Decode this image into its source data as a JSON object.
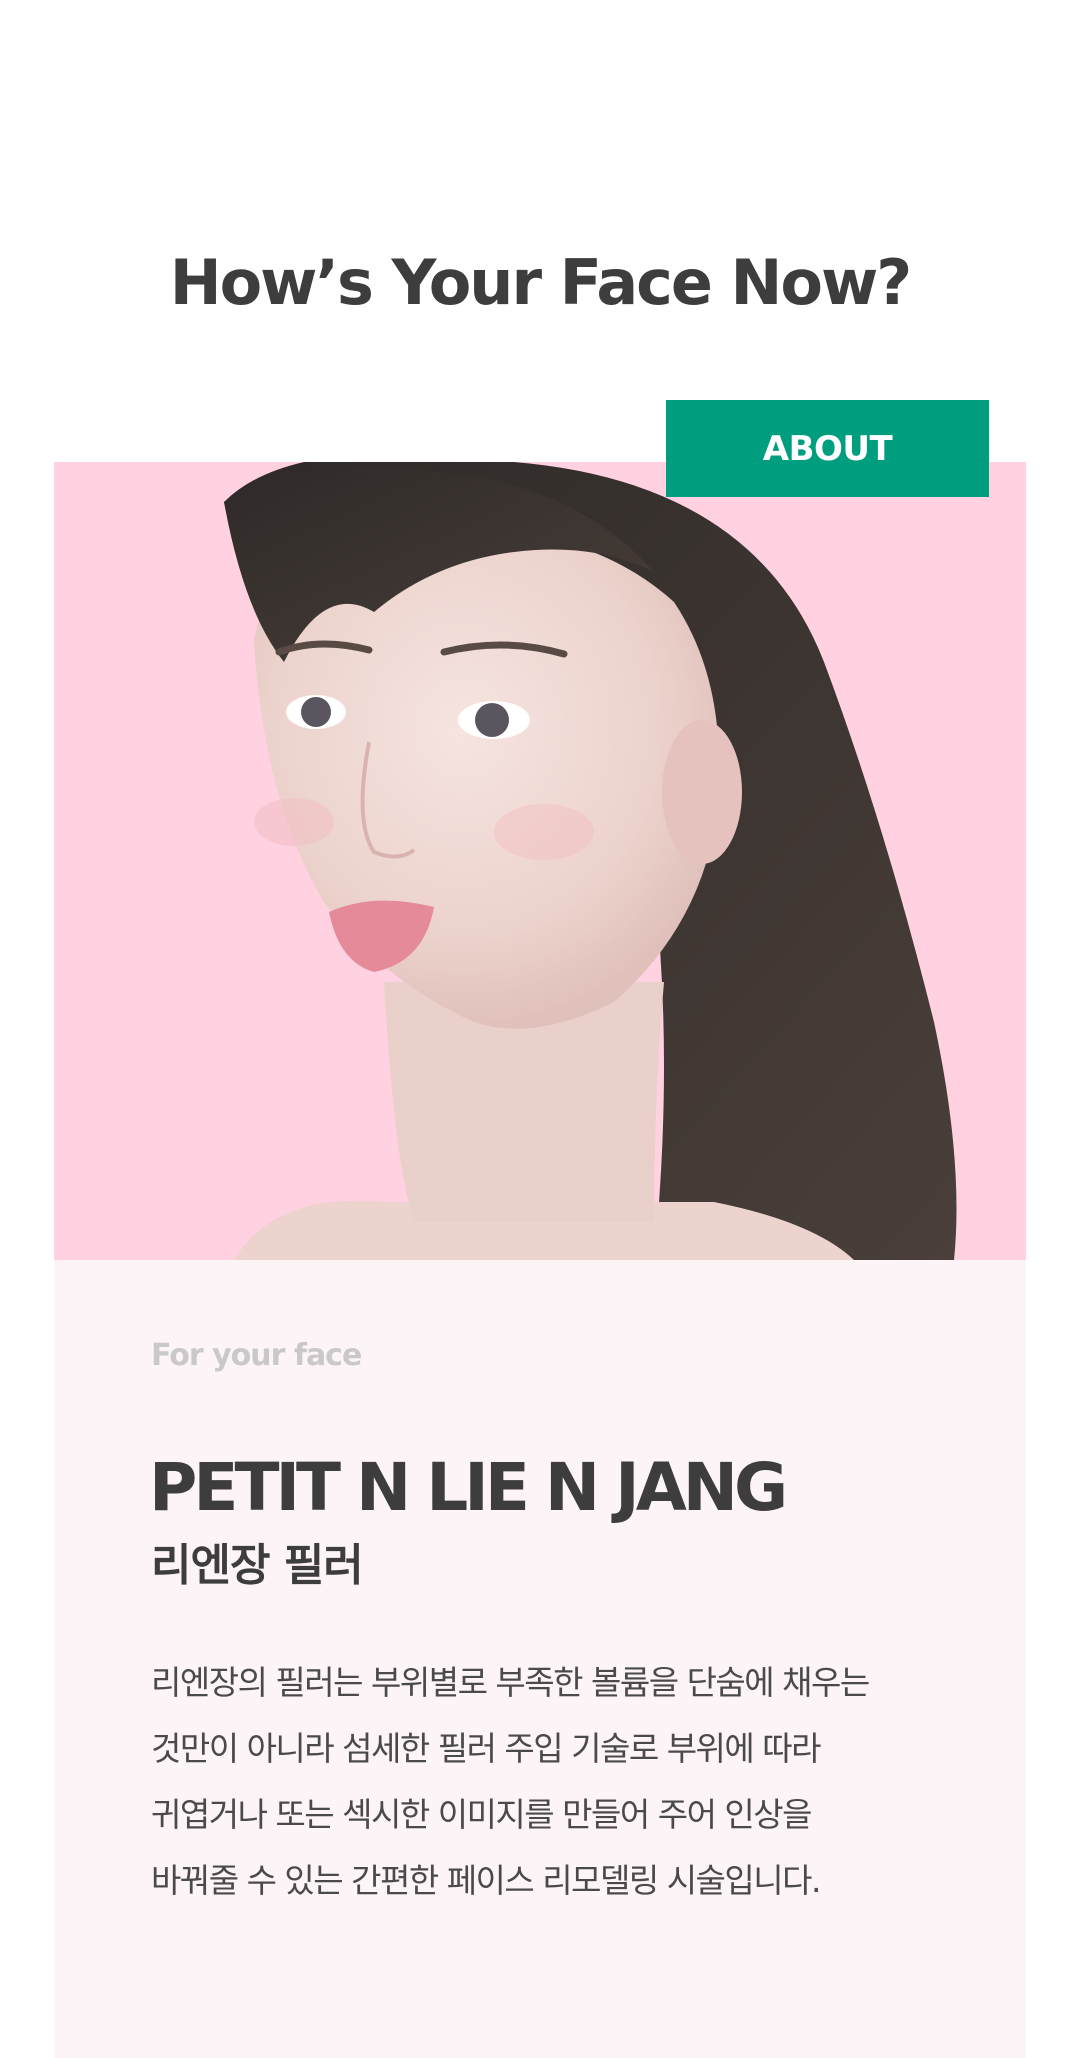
{
  "header": {
    "headline": "How’s Your Face Now?"
  },
  "hero": {
    "about_label": "ABOUT",
    "image_alt": "woman-portrait",
    "background_color": "#ffd1e1"
  },
  "product": {
    "eyebrow": "For your face",
    "title": "PETIT N LIE N JANG",
    "subtitle": "리엔장 필러",
    "description_lines": [
      "리엔장의 필러는 부위별로 부족한 볼륨을 단숨에 채우는",
      "것만이 아니라 섬세한 필러 주입 기술로 부위에 따라",
      "귀엽거나 또는 섹시한 이미지를 만들어 주어 인상을",
      "바꿔줄 수 있는 간편한 페이스 리모델링 시술입니다."
    ]
  },
  "colors": {
    "accent": "#009e7e",
    "text": "#3d3d3d",
    "panel": "#fdf4f7"
  }
}
